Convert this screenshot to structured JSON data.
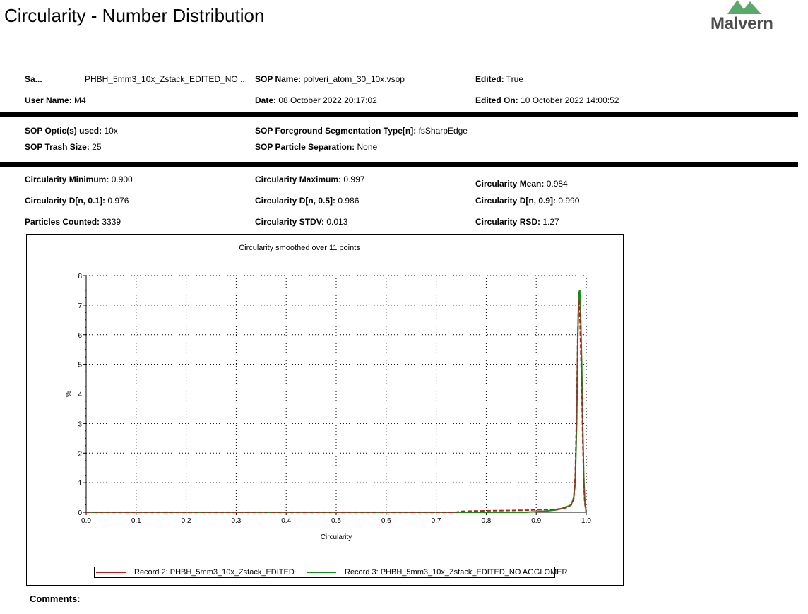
{
  "page": {
    "title": "Circularity - Number Distribution",
    "logo_text": "Malvern",
    "comments_label": "Comments:"
  },
  "header": {
    "row1": [
      {
        "label": "Sa...",
        "value": "PHBH_5mm3_10x_Zstack_EDITED_NO ..."
      },
      {
        "label": "SOP Name:",
        "value": "polveri_atom_30_10x.vsop"
      },
      {
        "label": "Edited:",
        "value": "True"
      }
    ],
    "row2": [
      {
        "label": "User Name:",
        "value": "M4"
      },
      {
        "label": "Date:",
        "value": "08 October 2022 20:17:02"
      },
      {
        "label": "Edited On:",
        "value": "10 October 2022 14:00:52"
      }
    ]
  },
  "sop": {
    "row1": [
      {
        "label": "SOP Optic(s) used:",
        "value": "10x"
      },
      {
        "label": "SOP Foreground Segmentation Type[n]:",
        "value": "fsSharpEdge"
      }
    ],
    "row2": [
      {
        "label": "SOP Trash Size:",
        "value": "25"
      },
      {
        "label": "SOP Particle Separation:",
        "value": "None"
      }
    ]
  },
  "stats": {
    "row1": [
      {
        "label": "Circularity Minimum:",
        "value": "0.900"
      },
      {
        "label": "Circularity Maximum:",
        "value": "0.997"
      },
      {
        "label": "Circularity Mean:",
        "value": "0.984"
      }
    ],
    "row2": [
      {
        "label": "Circularity D[n, 0.1]:",
        "value": "0.976"
      },
      {
        "label": "Circularity D[n, 0.5]:",
        "value": "0.986"
      },
      {
        "label": "Circularity D[n, 0.9]:",
        "value": "0.990"
      }
    ],
    "row3": [
      {
        "label": "Particles Counted:",
        "value": "3339"
      },
      {
        "label": "Circularity STDV:",
        "value": "0.013"
      },
      {
        "label": "Circularity RSD:",
        "value": "1.27"
      }
    ]
  },
  "colors": {
    "record2": "#b22222",
    "record3": "#1a8a1a",
    "logo_green": "#5aa96a",
    "grid": "#000000"
  },
  "chart_data": {
    "type": "line",
    "title": "Circularity smoothed over 11 points",
    "xlabel": "Circularity",
    "ylabel": "%",
    "xlim": [
      0.0,
      1.0
    ],
    "ylim": [
      0,
      8
    ],
    "x_ticks": [
      "0.0",
      "0.1",
      "0.2",
      "0.3",
      "0.4",
      "0.5",
      "0.6",
      "0.7",
      "0.8",
      "0.9",
      "1.0"
    ],
    "y_ticks": [
      "0",
      "1",
      "2",
      "3",
      "4",
      "5",
      "6",
      "7",
      "8"
    ],
    "grid": true,
    "legend_position": "bottom",
    "series": [
      {
        "name": "Record 2: PHBH_5mm3_10x_Zstack_EDITED",
        "color_key": "record2",
        "dashed": true,
        "x": [
          0.0,
          0.5,
          0.74,
          0.75,
          0.8,
          0.85,
          0.88,
          0.9,
          0.92,
          0.94,
          0.95,
          0.96,
          0.97,
          0.975,
          0.978,
          0.981,
          0.983,
          0.985,
          0.987,
          0.989,
          0.991,
          0.993,
          0.995,
          0.997,
          1.0
        ],
        "y": [
          0,
          0,
          0,
          0.03,
          0.05,
          0.06,
          0.07,
          0.08,
          0.09,
          0.1,
          0.12,
          0.15,
          0.25,
          0.45,
          1.2,
          3.5,
          6.0,
          7.2,
          6.8,
          5.5,
          4.3,
          2.5,
          1.0,
          0.3,
          0
        ]
      },
      {
        "name": "Record 3: PHBH_5mm3_10x_Zstack_EDITED_NO AGGLOMER",
        "color_key": "record3",
        "dashed": false,
        "x": [
          0.0,
          0.5,
          0.88,
          0.9,
          0.92,
          0.94,
          0.95,
          0.96,
          0.97,
          0.975,
          0.978,
          0.981,
          0.983,
          0.985,
          0.987,
          0.989,
          0.991,
          0.993,
          0.995,
          0.997,
          1.0
        ],
        "y": [
          0,
          0,
          0,
          0.02,
          0.04,
          0.08,
          0.12,
          0.18,
          0.25,
          0.5,
          1.0,
          3.0,
          5.8,
          7.4,
          7.5,
          6.5,
          5.0,
          3.0,
          1.2,
          0.4,
          0
        ]
      }
    ]
  }
}
